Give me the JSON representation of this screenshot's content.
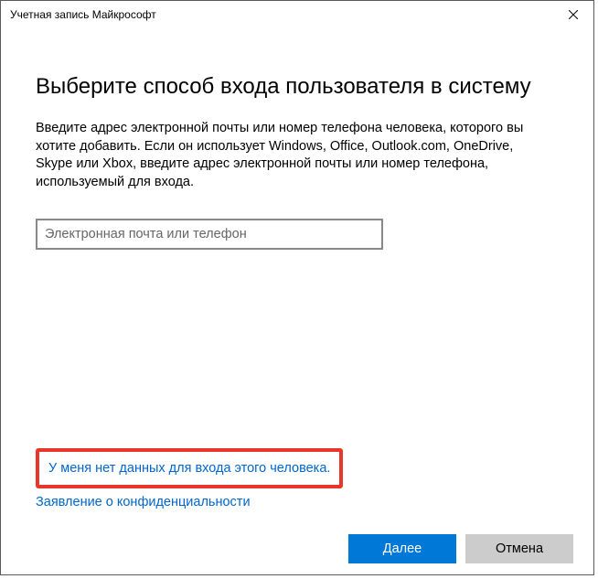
{
  "window": {
    "title": "Учетная запись Майкрософт"
  },
  "main": {
    "heading": "Выберите способ входа пользователя в систему",
    "description": "Введите адрес электронной почты или номер телефона человека, которого вы хотите добавить. Если он использует Windows, Office, Outlook.com, OneDrive, Skype или Xbox, введите адрес электронной почты или номер телефона, используемый для входа.",
    "input": {
      "placeholder": "Электронная почта или телефон",
      "value": ""
    }
  },
  "links": {
    "no_signin_info": "У меня нет данных для входа этого человека.",
    "privacy": "Заявление о конфиденциальности"
  },
  "footer": {
    "next": "Далее",
    "cancel": "Отмена"
  }
}
